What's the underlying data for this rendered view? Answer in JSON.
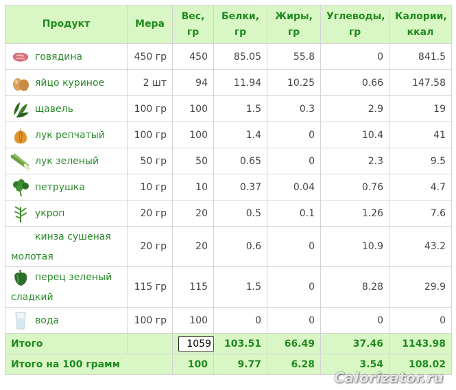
{
  "table": {
    "headers": {
      "product": "Продукт",
      "measure": "Мера",
      "weight": "Вес, гр",
      "protein": "Белки, гр",
      "fat": "Жиры, гр",
      "carbs": "Углеводы, гр",
      "calories": "Калории, ккал"
    },
    "rows": [
      {
        "name": "говядина",
        "icon": "beef-icon",
        "measure": "450 гр",
        "weight": "450",
        "protein": "85.05",
        "fat": "55.8",
        "carbs": "0",
        "calories": "841.5"
      },
      {
        "name": "яйцо куриное",
        "icon": "eggs-icon",
        "measure": "2 шт",
        "weight": "94",
        "protein": "11.94",
        "fat": "10.25",
        "carbs": "0.66",
        "calories": "147.58"
      },
      {
        "name": "щавель",
        "icon": "sorrel-icon",
        "measure": "100 гр",
        "weight": "100",
        "protein": "1.5",
        "fat": "0.3",
        "carbs": "2.9",
        "calories": "19"
      },
      {
        "name": "лук репчатый",
        "icon": "onion-icon",
        "measure": "100 гр",
        "weight": "100",
        "protein": "1.4",
        "fat": "0",
        "carbs": "10.4",
        "calories": "41"
      },
      {
        "name": "лук зеленый",
        "icon": "green-onion-icon",
        "measure": "50 гр",
        "weight": "50",
        "protein": "0.65",
        "fat": "0",
        "carbs": "2.3",
        "calories": "9.5"
      },
      {
        "name": "петрушка",
        "icon": "parsley-icon",
        "measure": "10 гр",
        "weight": "10",
        "protein": "0.37",
        "fat": "0.04",
        "carbs": "0.76",
        "calories": "4.7"
      },
      {
        "name": "укроп",
        "icon": "dill-icon",
        "measure": "20 гр",
        "weight": "20",
        "protein": "0.5",
        "fat": "0.1",
        "carbs": "1.26",
        "calories": "7.6"
      },
      {
        "name": "кинза сушеная молотая",
        "icon": "",
        "measure": "20 гр",
        "weight": "20",
        "protein": "0.6",
        "fat": "0",
        "carbs": "10.9",
        "calories": "43.2"
      },
      {
        "name": "перец зеленый сладкий",
        "icon": "green-pepper-icon",
        "measure": "115 гр",
        "weight": "115",
        "protein": "1.5",
        "fat": "0",
        "carbs": "8.28",
        "calories": "29.9"
      },
      {
        "name": "вода",
        "icon": "water-glass-icon",
        "measure": "100 гр",
        "weight": "100",
        "protein": "0",
        "fat": "0",
        "carbs": "0",
        "calories": "0"
      }
    ],
    "total": {
      "label": "Итого",
      "weight_value": "1059",
      "protein": "103.51",
      "fat": "66.49",
      "carbs": "37.46",
      "calories": "1143.98"
    },
    "per100": {
      "label": "Итого на 100 грамм",
      "weight": "100",
      "protein": "9.77",
      "fat": "6.28",
      "carbs": "3.54",
      "calories": "108.02"
    }
  },
  "watermark": "Calorizator.ru",
  "colors": {
    "header_bg": "#d9f7c4",
    "header_text": "#1f8a1f",
    "name_text": "#2a8a2a",
    "border": "#d4d4d4"
  }
}
